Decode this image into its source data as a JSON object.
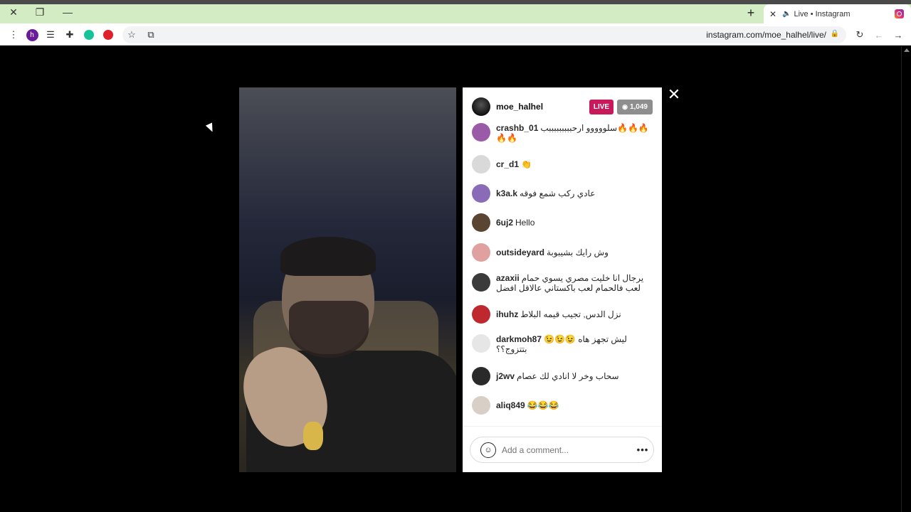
{
  "browser": {
    "tab_title": "Live • Instagram",
    "url": "instagram.com/moe_halhel/live/",
    "ext_h_letter": "h"
  },
  "live": {
    "username": "moe_halhel",
    "live_label": "LIVE",
    "viewers": "1,049",
    "comment_placeholder": "Add a comment...",
    "more": "•••"
  },
  "comments": [
    {
      "user": "crashb_01",
      "text": "سلووووو ارحبببببببببب🔥🔥🔥🔥🔥",
      "avatar_color": "#9b5aa8"
    },
    {
      "user": "cr_d1",
      "text": "👏",
      "avatar_color": "#d9d9d9"
    },
    {
      "user": "k3a.k",
      "text": "عادي ركب شمع فوقه",
      "avatar_color": "#8a6bb8"
    },
    {
      "user": "6uj2",
      "text": "Hello",
      "avatar_color": "#5a4432"
    },
    {
      "user": "outsideyard",
      "text": "وش رايك بشيبوبة",
      "avatar_color": "#e0a0a0"
    },
    {
      "user": "azaxii",
      "text": "يرجال انا خليت مصري يسوي حمام لعب فالحمام لعب باكستاني عالاقل افضل",
      "avatar_color": "#3b3b3b"
    },
    {
      "user": "ihuhz",
      "text": "نزل الدس, تجيب قيمه البلاط",
      "avatar_color": "#c0282f"
    },
    {
      "user": "darkmoh87",
      "text": "😉😉😉 ليش تجهز هاه بتتزوج؟؟",
      "avatar_color": "#e6e6e6"
    },
    {
      "user": "j2wv",
      "text": "سحاب وخر لا انادي لك عصام",
      "avatar_color": "#2a2a2a"
    },
    {
      "user": "aliq849",
      "text": "😂😂😂",
      "avatar_color": "#d8cfc6"
    }
  ],
  "colors": {
    "live_badge": "#c8195b",
    "viewer_badge": "#8e8e8e",
    "tabstrip": "#d4ecc4"
  },
  "icons": {
    "close_window": "close-icon",
    "restore": "restore-icon",
    "minimize": "minimize-icon",
    "menu": "kebab-menu-icon",
    "playlist": "playlist-icon",
    "extensions": "puzzle-icon",
    "bookmark": "star-icon",
    "reload": "reload-icon",
    "back": "back-arrow-icon",
    "forward": "forward-arrow-icon",
    "close_live": "close-icon"
  }
}
